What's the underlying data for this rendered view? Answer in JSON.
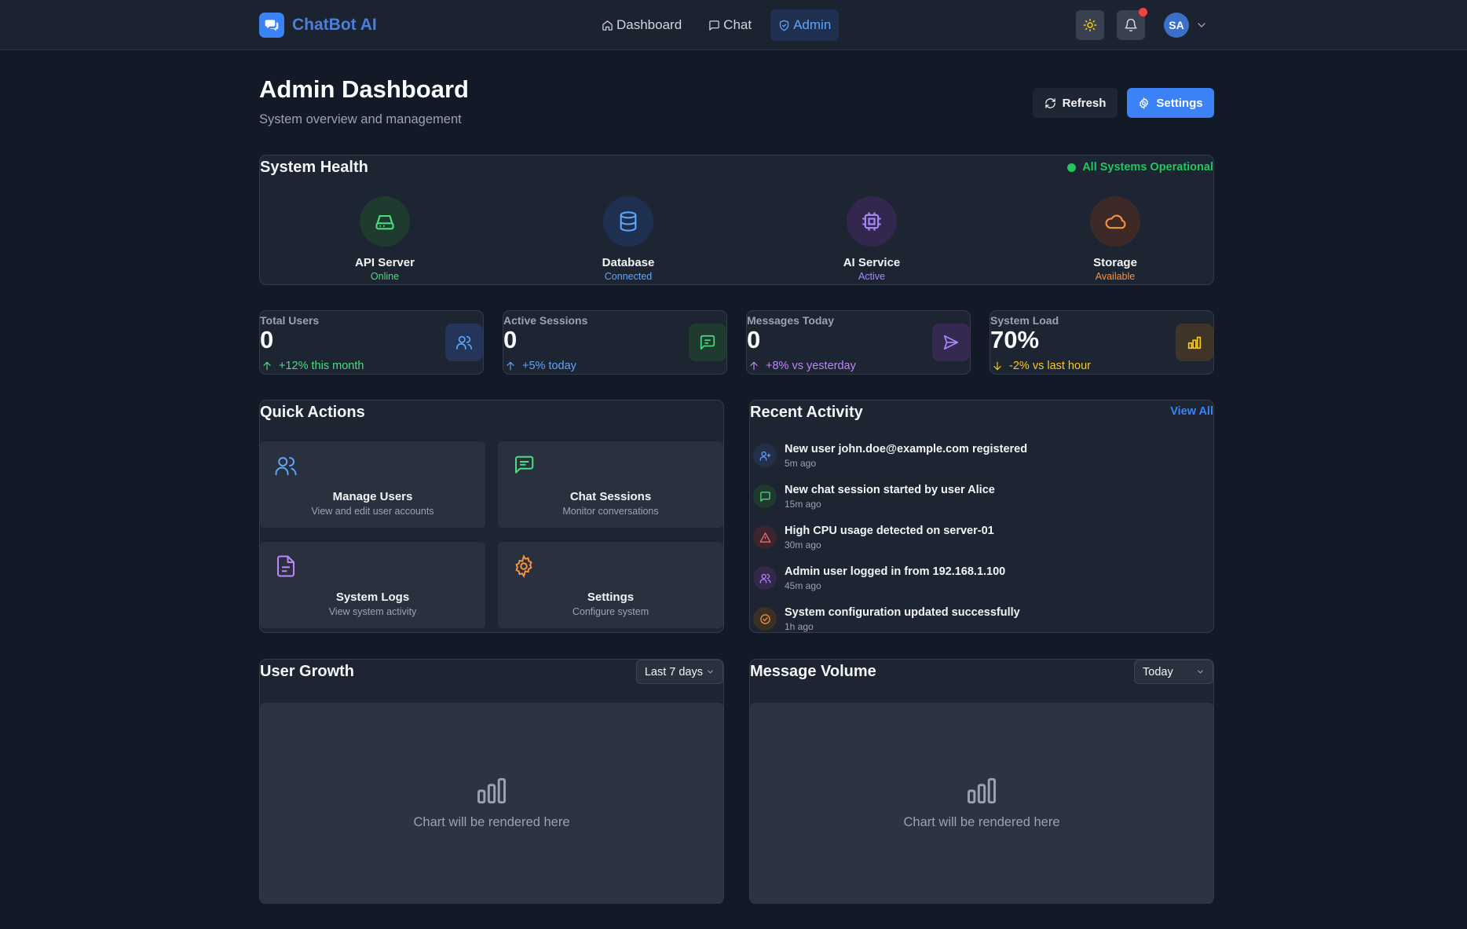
{
  "app": {
    "name": "ChatBot AI"
  },
  "nav": {
    "items": [
      {
        "label": "Dashboard",
        "icon": "home-icon"
      },
      {
        "label": "Chat",
        "icon": "chat-icon"
      },
      {
        "label": "Admin",
        "icon": "shield-icon",
        "active": true
      }
    ]
  },
  "user": {
    "initials": "SA"
  },
  "header": {
    "title": "Admin Dashboard",
    "subtitle": "System overview and management",
    "refresh_label": "Refresh",
    "settings_label": "Settings"
  },
  "health": {
    "title": "System Health",
    "overall_status": "All Systems Operational",
    "services": [
      {
        "name": "API Server",
        "status": "Online",
        "icon": "server-icon",
        "color": "#4ade80"
      },
      {
        "name": "Database",
        "status": "Connected",
        "icon": "database-icon",
        "color": "#60a5fa"
      },
      {
        "name": "AI Service",
        "status": "Active",
        "icon": "cpu-icon",
        "color": "#a78bfa"
      },
      {
        "name": "Storage",
        "status": "Available",
        "icon": "cloud-icon",
        "color": "#fb923c"
      }
    ]
  },
  "stats": [
    {
      "label": "Total Users",
      "value": "0",
      "change": "+12% this month",
      "trend": "up",
      "icon": "users-icon",
      "color": "#4ade80"
    },
    {
      "label": "Active Sessions",
      "value": "0",
      "change": "+5% today",
      "trend": "up",
      "icon": "chat-icon",
      "color": "#60a5fa"
    },
    {
      "label": "Messages Today",
      "value": "0",
      "change": "+8% vs yesterday",
      "trend": "up",
      "icon": "send-icon",
      "color": "#c084fc"
    },
    {
      "label": "System Load",
      "value": "70%",
      "change": "-2% vs last hour",
      "trend": "down",
      "icon": "bar-chart-icon",
      "color": "#facc15"
    }
  ],
  "quick_actions": {
    "title": "Quick Actions",
    "items": [
      {
        "title": "Manage Users",
        "desc": "View and edit user accounts",
        "icon": "users-icon"
      },
      {
        "title": "Chat Sessions",
        "desc": "Monitor conversations",
        "icon": "chat-icon"
      },
      {
        "title": "System Logs",
        "desc": "View system activity",
        "icon": "file-text-icon"
      },
      {
        "title": "Settings",
        "desc": "Configure system",
        "icon": "gear-icon"
      }
    ]
  },
  "activity": {
    "title": "Recent Activity",
    "view_all": "View All",
    "items": [
      {
        "text": "New user john.doe@example.com registered",
        "time": "5m ago",
        "icon": "user-plus-icon"
      },
      {
        "text": "New chat session started by user Alice",
        "time": "15m ago",
        "icon": "chat-icon"
      },
      {
        "text": "High CPU usage detected on server-01",
        "time": "30m ago",
        "icon": "warning-icon"
      },
      {
        "text": "Admin user logged in from 192.168.1.100",
        "time": "45m ago",
        "icon": "users-icon"
      },
      {
        "text": "System configuration updated successfully",
        "time": "1h ago",
        "icon": "check-circle-icon"
      }
    ]
  },
  "charts": {
    "user_growth": {
      "title": "User Growth",
      "range": "Last 7 days",
      "placeholder": "Chart will be rendered here"
    },
    "message_volume": {
      "title": "Message Volume",
      "range": "Today",
      "placeholder": "Chart will be rendered here"
    }
  }
}
